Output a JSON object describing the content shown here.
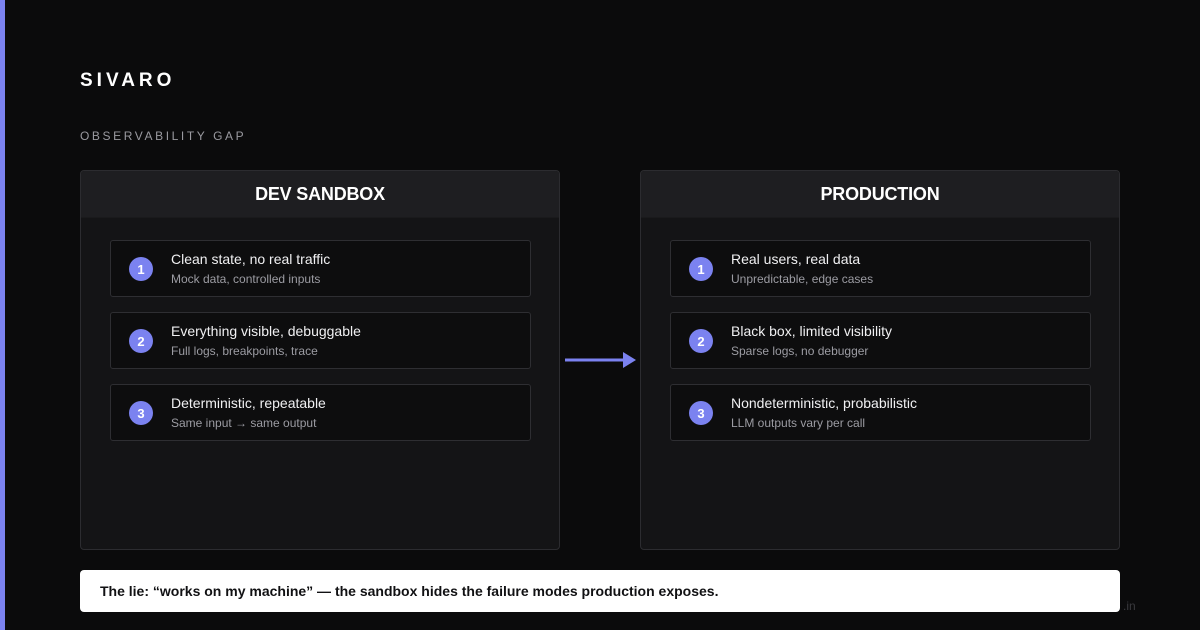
{
  "brand": "SIVARO",
  "section_label": "OBSERVABILITY GAP",
  "colors": {
    "accent": "#7b82f0",
    "background": "#0b0b0c",
    "panel": "#141416",
    "callout_bg": "#ffffff"
  },
  "left_panel": {
    "title": "DEV SANDBOX",
    "items": [
      {
        "number": "1",
        "title": "Clean state, no real traffic",
        "subtitle": "Mock data, controlled inputs"
      },
      {
        "number": "2",
        "title": "Everything visible, debuggable",
        "subtitle": "Full logs, breakpoints, trace"
      },
      {
        "number": "3",
        "title": "Deterministic, repeatable",
        "subtitle": "Same input → same output"
      }
    ]
  },
  "right_panel": {
    "title": "PRODUCTION",
    "items": [
      {
        "number": "1",
        "title": "Real users, real data",
        "subtitle": "Unpredictable, edge cases"
      },
      {
        "number": "2",
        "title": "Black box, limited visibility",
        "subtitle": "Sparse logs, no debugger"
      },
      {
        "number": "3",
        "title": "Nondeterministic, probabilistic",
        "subtitle": "LLM outputs vary per call"
      }
    ]
  },
  "callout": "The lie: “works on my machine” — the sandbox hides the failure modes production exposes.",
  "watermark": ".in"
}
